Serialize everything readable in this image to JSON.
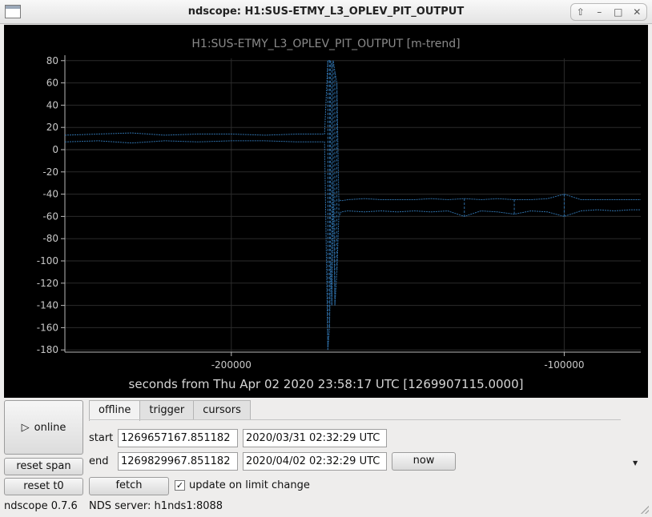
{
  "window": {
    "title": "ndscope: H1:SUS-ETMY_L3_OPLEV_PIT_OUTPUT"
  },
  "window_buttons": [
    "⇧",
    "–",
    "□",
    "✕"
  ],
  "colors": {
    "trace": "#2e6ea6",
    "grid": "#2b2b2b",
    "axis": "#b8b8b8",
    "background": "#000000"
  },
  "chart_data": {
    "type": "line",
    "title": "H1:SUS-ETMY_L3_OPLEV_PIT_OUTPUT [m-trend]",
    "xlabel": "seconds from Thu Apr 02 2020 23:58:17 UTC [1269907115.0000]",
    "ylabel": "",
    "xlim": [
      -250000,
      -77000
    ],
    "ylim": [
      -182,
      82
    ],
    "x_ticks": [
      -200000,
      -100000
    ],
    "x_tick_labels": [
      "-200000",
      "-100000"
    ],
    "y_ticks": [
      80,
      60,
      40,
      20,
      0,
      -20,
      -40,
      -60,
      -80,
      -100,
      -120,
      -140,
      -160,
      -180
    ],
    "grid": true,
    "series": [
      {
        "kind": "min-max-envelope",
        "x": [
          -250000,
          -240000,
          -230000,
          -220000,
          -210000,
          -200000,
          -190000,
          -180000,
          -172000,
          -171000,
          -170500,
          -170200,
          -169800,
          -169400,
          -168900,
          -168300,
          -167700,
          -167000,
          -165000,
          -160000,
          -155000,
          -150000,
          -145000,
          -140000,
          -135000,
          -130000,
          -125000,
          -120000,
          -115000,
          -110000,
          -105000,
          -100000,
          -95000,
          -90000,
          -85000,
          -80000,
          -77000
        ],
        "min": [
          7,
          8,
          6,
          8,
          7,
          8,
          8,
          7,
          7,
          -180,
          -160,
          -100,
          -140,
          -30,
          -140,
          -110,
          -60,
          -56,
          -55,
          -56,
          -55,
          -56,
          -55,
          -56,
          -55,
          -60,
          -55,
          -56,
          -58,
          -55,
          -56,
          -60,
          -55,
          -54,
          -55,
          -54,
          -54
        ],
        "max": [
          13,
          14,
          15,
          13,
          14,
          14,
          13,
          14,
          14,
          80,
          80,
          80,
          75,
          80,
          70,
          60,
          -45,
          -46,
          -45,
          -44,
          -45,
          -45,
          -45,
          -44,
          -45,
          -44,
          -45,
          -44,
          -45,
          -45,
          -44,
          -40,
          -45,
          -45,
          -45,
          -45,
          -45
        ]
      }
    ]
  },
  "controls": {
    "online_label": "online",
    "online_icon": "▷",
    "reset_span": "reset span",
    "reset_t0": "reset t0",
    "tabs": [
      "offline",
      "trigger",
      "cursors"
    ],
    "start_label": "start",
    "start_gps": "1269657167.851182",
    "start_utc": "2020/03/31 02:32:29 UTC",
    "end_label": "end",
    "end_gps": "1269829967.851182",
    "end_utc": "2020/04/02 02:32:29 UTC",
    "now": "now",
    "fetch": "fetch",
    "update_checkbox_label": "update on limit change",
    "update_checked": "✓"
  },
  "status": {
    "version": "ndscope 0.7.6",
    "server": "NDS server: h1nds1:8088"
  }
}
